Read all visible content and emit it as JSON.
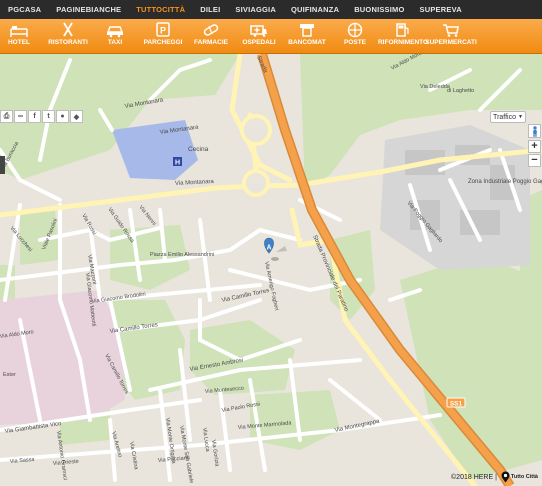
{
  "topnav": [
    {
      "label": "PGCASA",
      "active": false
    },
    {
      "label": "PAGINEBIANCHE",
      "active": false
    },
    {
      "label": "TUTTOCITTÀ",
      "active": true
    },
    {
      "label": "DILEI",
      "active": false
    },
    {
      "label": "SIVIAGGIA",
      "active": false
    },
    {
      "label": "QUIFINANZA",
      "active": false
    },
    {
      "label": "BUONISSIMO",
      "active": false
    },
    {
      "label": "SUPEREVA",
      "active": false
    }
  ],
  "categories": [
    {
      "label": "HOTEL",
      "icon": "bed-icon"
    },
    {
      "label": "RISTORANTI",
      "icon": "cutlery-icon"
    },
    {
      "label": "TAXI",
      "icon": "car-icon"
    },
    {
      "label": "PARCHEGGI",
      "icon": "parking-icon"
    },
    {
      "label": "FARMACIE",
      "icon": "pill-icon"
    },
    {
      "label": "OSPEDALI",
      "icon": "ambulance-icon"
    },
    {
      "label": "BANCOMAT",
      "icon": "atm-icon"
    },
    {
      "label": "POSTE",
      "icon": "post-icon"
    },
    {
      "label": "RIFORNIMENTO",
      "icon": "fuel-icon"
    },
    {
      "label": "SUPERMERCATI",
      "icon": "cart-icon"
    }
  ],
  "share_icons": [
    "printer-icon",
    "link-icon",
    "facebook-icon",
    "twitter-icon",
    "apple-icon",
    "android-icon"
  ],
  "map": {
    "traffic_label": "Traffico",
    "zoom_in": "+",
    "zoom_out": "−",
    "marker_letter": "A",
    "copyright": "©2018 HERE |",
    "brand": "Tutto Città",
    "road_badge": "SS1",
    "colors": {
      "primary_road": "#f5a04a",
      "secondary_road": "#fff4b5",
      "green": "#cfe2b8",
      "urban": "#e9e5dc",
      "industrial": "#d6d6d6",
      "pink": "#e8d3dc",
      "poi": "#a7b9e8",
      "marker": "#3f80c6",
      "accent": "#f7931e"
    }
  },
  "streets": [
    "Via Montanara",
    "Via Montanara",
    "Cecina",
    "Via Montanara",
    "Strada",
    "Via Aldo Moro",
    "Via Deledda",
    "di Laghetto",
    "Zona Industriale Poggio Gagliardo",
    "Via Poggio Gagliardo",
    "Via Buraccia",
    "Via Lucchesi",
    "Viale Pasolini",
    "Via Rossi",
    "Via Guido Rossa",
    "Via Nenni",
    "Via Mazzoni",
    "Piazza Emilio Alessandrini",
    "Via Giacomo Matteotti",
    "Via Giacomo Brodolini",
    "Via Camillo Torres",
    "Via Camillo Torres",
    "Via Amerigo Fogheri",
    "Strada Provinciale del Paratino",
    "Via Aldo Moro",
    "Via Camillo Torres",
    "Ester",
    "Via Ernesto Ambrosi",
    "Via Montesecco",
    "Via Paolo Rossi",
    "Via Monte Marmolada",
    "Via Montegrappa",
    "Via Giambattista Vico",
    "Via Antonio Gramsci",
    "Via Aretino",
    "Via Cristina",
    "Via Monte Ortigara",
    "Via Monte San Gabriele",
    "Via Lucca",
    "Via Gorizia",
    "Via Sassa",
    "Via Trieste",
    "Via Pacciardi"
  ]
}
